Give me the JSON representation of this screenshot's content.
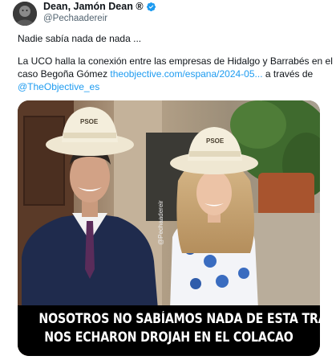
{
  "author": {
    "display_name": "Dean, Jamón Dean ®",
    "handle": "@Pechaadereir",
    "verified": true
  },
  "tweet": {
    "line1": "Nadie sabía nada de nada ...",
    "line2": "La UCO halla la conexión entre las empresas de Hidalgo y Barrabés en el",
    "line3_prefix": "caso Begoña Gómez ",
    "line3_link": "theobjective.com/espana/2024-05...",
    "line3_suffix": " a través de",
    "line4_mention": "@TheObjective_es"
  },
  "media": {
    "caption_line1": "NOSOTROS NO SABÍAMOS NADA DE ESTA TRAMA",
    "caption_line2": "NOS ECHARON DROJAH EN EL COLACAO",
    "hat_label_left": "PSOE",
    "hat_label_right": "PSOE",
    "watermark": "@Pechaadereir"
  },
  "colors": {
    "link": "#1d9bf0",
    "verified": "#1d9bf0",
    "handle": "#536471"
  }
}
